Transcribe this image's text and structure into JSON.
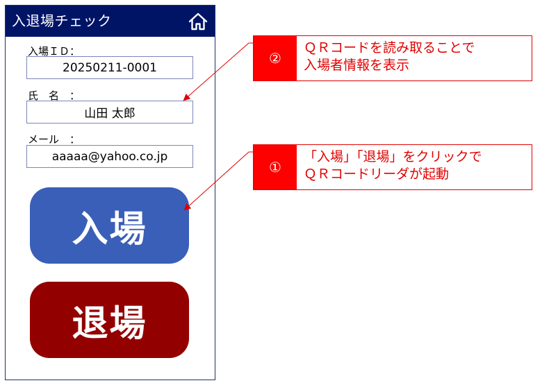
{
  "app": {
    "title": "入退場チェック",
    "home_icon": "home-icon"
  },
  "form": {
    "id_label": "入場ＩＤ：",
    "id_value": "20250211-0001",
    "name_label": "氏　名　：",
    "name_value": "山田 太郎",
    "mail_label": "メール　：",
    "mail_value": "aaaaa@yahoo.co.jp"
  },
  "buttons": {
    "enter": "入場",
    "exit": "退場"
  },
  "callouts": {
    "qr_display": {
      "number": "②",
      "line1": "ＱＲコードを読み取ることで",
      "line2": "入場者情報を表示"
    },
    "button_info": {
      "number": "①",
      "line1": "「入場」「退場」をクリックで",
      "line2": "ＱＲコードリーダが起動"
    }
  },
  "colors": {
    "appbar": "#001466",
    "enter_button": "#3a5fb8",
    "exit_button": "#930000",
    "callout_accent": "#ff0000"
  }
}
